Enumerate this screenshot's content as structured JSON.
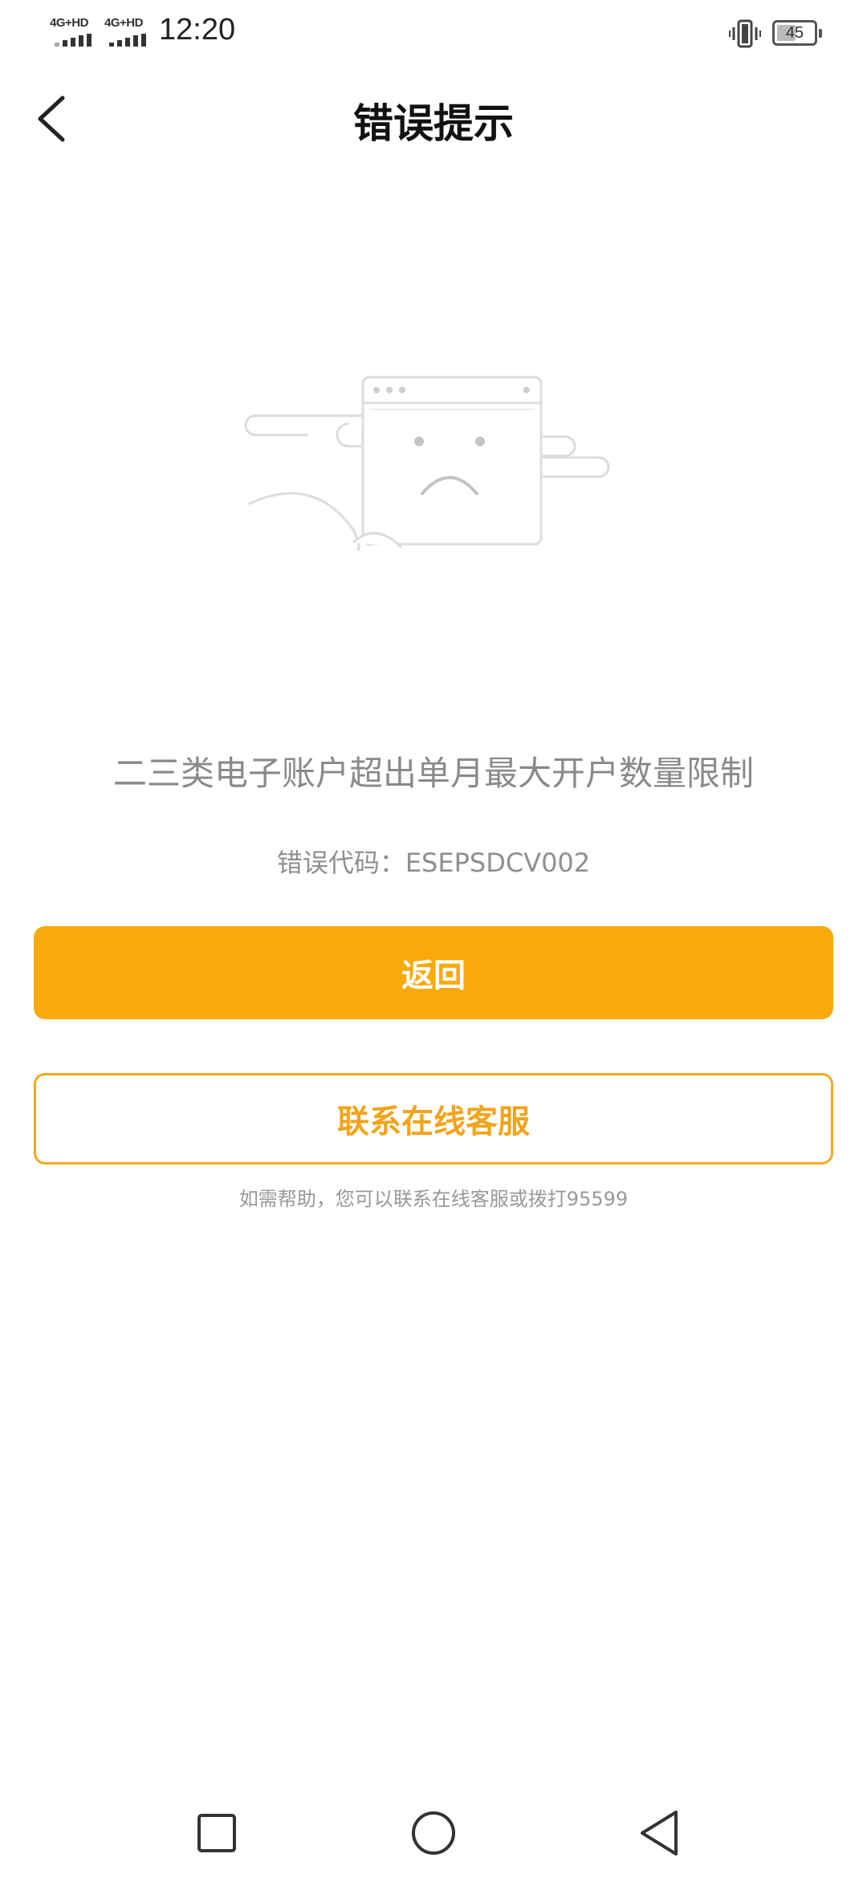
{
  "status_bar": {
    "network_1": "4G+HD",
    "network_2": "4G+HD",
    "time": "12:20",
    "battery_level": "45",
    "icons": [
      "signal-icon",
      "vibrate-icon",
      "battery-icon"
    ]
  },
  "header": {
    "title": "错误提示",
    "back_icon": "chevron-left-icon"
  },
  "illustration": {
    "icon": "sad-browser-window-icon"
  },
  "main": {
    "message": "二三类电子账户超出单月最大开户数量限制",
    "error_code": "错误代码：ESEPSDCV002"
  },
  "actions": {
    "return_label": "返回",
    "service_label": "联系在线客服",
    "help_text": "如需帮助，您可以联系在线客服或拨打95599"
  },
  "navigation": {
    "icons": [
      "recent-apps-icon",
      "home-icon",
      "back-icon"
    ]
  },
  "colors": {
    "accent": "#f9aa0a",
    "outline": "#f2ab20",
    "muted_text": "#8a8a8a"
  }
}
